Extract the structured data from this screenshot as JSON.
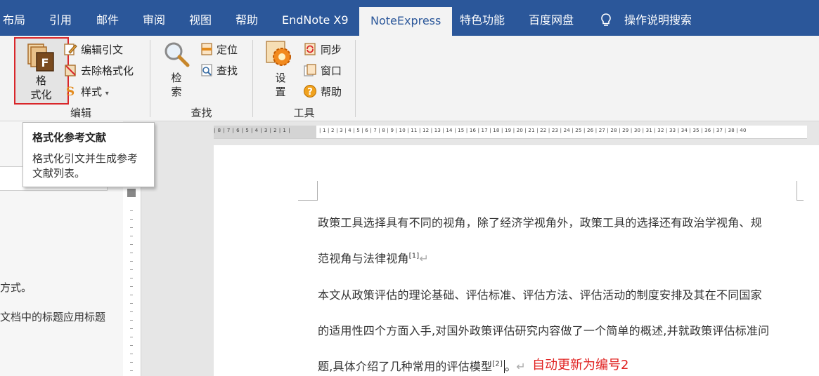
{
  "tabs": [
    "布局",
    "引用",
    "邮件",
    "审阅",
    "视图",
    "帮助",
    "EndNote X9",
    "NoteExpress",
    "特色功能",
    "百度网盘",
    "操作说明搜索"
  ],
  "active_tab": "NoteExpress",
  "ribbon": {
    "edit_group": {
      "label": "编辑",
      "format_button": "格式化",
      "format_line1": "格",
      "format_line2": "式化",
      "edit_citation": "编辑引文",
      "remove_format": "去除格式化",
      "style": "样式"
    },
    "find_group": {
      "label": "查找",
      "search_line1": "检",
      "search_line2": "索",
      "locate": "定位",
      "find": "查找"
    },
    "tools_group": {
      "label": "工具",
      "settings_line1": "设",
      "settings_line2": "置",
      "sync": "同步",
      "window": "窗口",
      "help": "帮助"
    }
  },
  "tooltip": {
    "title": "格式化参考文献",
    "desc_line1": "格式化引文并生成参考",
    "desc_line2": "文献列表。"
  },
  "left_pane": {
    "line1": "方式。",
    "line2": "文档中的标题应用标题"
  },
  "document": {
    "p1_line1": "政策工具选择具有不同的视角，除了经济学视角外，政策工具的选择还有政治学视角、规",
    "p1_line2": "范视角与法律视角",
    "p1_ref": "[1]",
    "p2_line1": "本文从政策评估的理论基础、评估标准、评估方法、评估活动的制度安排及其在不同国家",
    "p2_line2": "的适用性四个方面入手,对国外政策评估研究内容做了一个简单的概述,并就政策评估标准问",
    "p2_line3": "题,具体介绍了几种常用的评估模型",
    "p2_ref": "[2]",
    "p2_end": "。",
    "annotation": "自动更新为编号2"
  },
  "ruler_labels": "| 8 | 7 | 6 | 5 | 4 | 3 | 2 | 1 |",
  "ruler_right": "| 1 | 2 | 3 | 4 | 5 | 6 | 7 | 8 | 9 | 10 | 11 | 12 | 13 | 14 | 15 | 16 | 17 | 18 | 19 | 20 | 21 | 22 | 23 | 24 | 25 | 26 | 27 | 28 | 29 | 30 | 31 | 32 | 33 | 34 | 35 | 36 | 37 | 38 | 40",
  "colors": {
    "tab_bar": "#2b579a",
    "highlight_box": "#d9262a",
    "annotation": "#e0201f"
  },
  "icons": [
    "format-icon",
    "edit-citation-icon",
    "remove-format-icon",
    "style-icon",
    "search-icon",
    "locate-icon",
    "find-icon",
    "settings-gear-icon",
    "sync-icon",
    "window-icon",
    "help-icon",
    "lightbulb-icon"
  ]
}
